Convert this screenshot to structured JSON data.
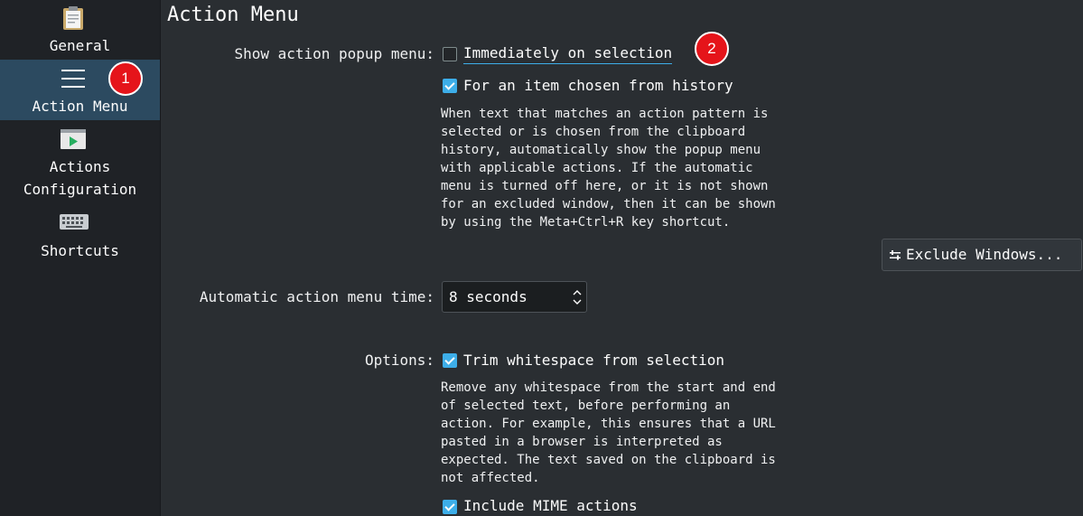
{
  "sidebar": {
    "items": [
      {
        "label_lines": [
          "General"
        ],
        "icon": "clipboard-icon",
        "selected": false
      },
      {
        "label_lines": [
          "Action Menu"
        ],
        "icon": "menu-icon",
        "selected": true
      },
      {
        "label_lines": [
          "Actions",
          "Configuration"
        ],
        "icon": "play-window-icon",
        "selected": false
      },
      {
        "label_lines": [
          "Shortcuts"
        ],
        "icon": "keyboard-icon",
        "selected": false
      }
    ]
  },
  "page": {
    "title": "Action Menu",
    "show_popup": {
      "label": "Show action popup menu:",
      "immediately": {
        "label": "Immediately on selection",
        "checked": false
      },
      "from_history": {
        "label": "For an item chosen from history",
        "checked": true
      },
      "description_lines": [
        "When text that matches an action pattern is",
        "selected or is chosen from the clipboard",
        "history, automatically show the popup menu",
        "with applicable actions. If the automatic",
        "menu is turned off here, or it is not shown",
        "for an excluded window, then it can be shown",
        "by using the Meta+Ctrl+R key shortcut."
      ]
    },
    "exclude_button": {
      "label": "Exclude Windows...",
      "icon": "settings-sliders-icon"
    },
    "menu_time": {
      "label": "Automatic action menu time:",
      "value": "8 seconds"
    },
    "options": {
      "label": "Options:",
      "trim": {
        "label": "Trim whitespace from selection",
        "checked": true
      },
      "trim_description_lines": [
        "Remove any whitespace from the start and end",
        "of selected text, before performing an",
        "action. For example, this ensures that a URL",
        "pasted in a browser is interpreted as",
        "expected. The text saved on the clipboard is",
        "not affected."
      ],
      "mime": {
        "label": "Include MIME actions",
        "checked": true
      }
    }
  },
  "annotations": [
    "1",
    "2"
  ],
  "colors": {
    "accent": "#3daee9",
    "selection": "#2c4a60",
    "badge": "#e5141a"
  }
}
